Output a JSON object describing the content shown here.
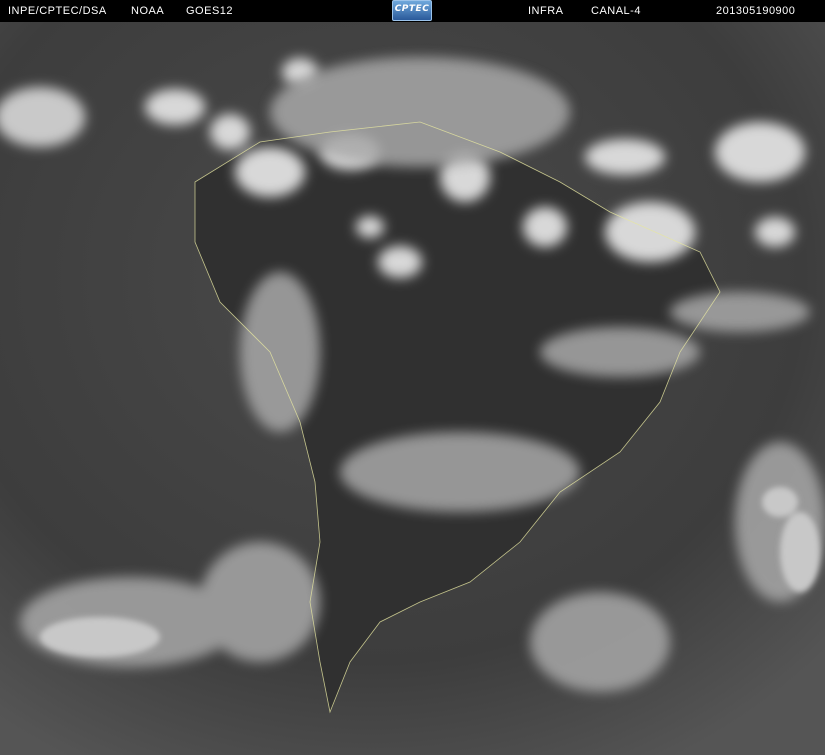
{
  "header": {
    "institution": "INPE/CPTEC/DSA",
    "agency": "NOAA",
    "satellite": "GOES12",
    "channel_type": "INFRA",
    "band": "CANAL-4",
    "timestamp": "201305190900",
    "logo_text": "CPTEC"
  },
  "colors": {
    "header_bg": "#000000",
    "header_text": "#ffffff",
    "space_bg": "#ffffff",
    "ocean": "#3c3c3c",
    "cloud": "#e8e8e8",
    "coastline": "#e6e6a0"
  },
  "image": {
    "description_type": "infrared satellite full-disk (South America)"
  }
}
